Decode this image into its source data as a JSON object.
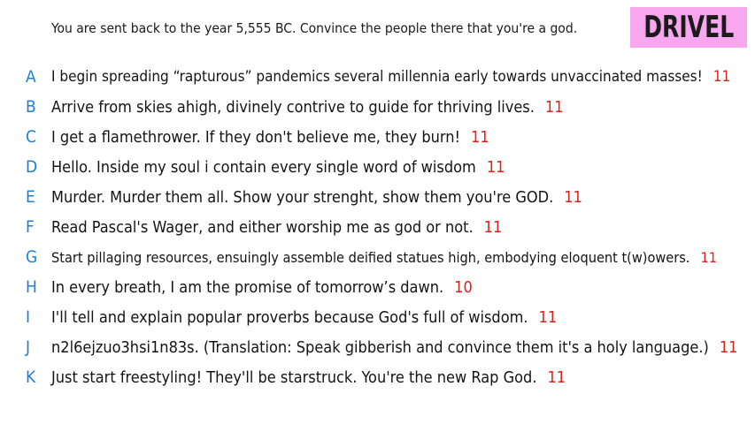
{
  "prompt": "You are sent back to the year 5,555 BC. Convince the people there that you're a god.",
  "logo": "DRIVEL",
  "colors": {
    "letter": "#1f7fd6",
    "score": "#e0201a",
    "logo_bg": "#f9a6f0"
  },
  "answers": [
    {
      "letter": "A",
      "text": "I begin spreading “rapturous” pandemics several millennia early towards unvaccinated masses!",
      "score": "11"
    },
    {
      "letter": "B",
      "text": "Arrive from skies ahigh, divinely contrive to guide for thriving lives.",
      "score": "11"
    },
    {
      "letter": "C",
      "text": "I get a flamethrower. If they don't believe me, they burn!",
      "score": "11"
    },
    {
      "letter": "D",
      "text": "Hello. Inside my soul i contain every single word of wisdom",
      "score": "11"
    },
    {
      "letter": "E",
      "text": "Murder. Murder them all. Show your strenght, show them you're GOD.",
      "score": "11"
    },
    {
      "letter": "F",
      "text": "Read Pascal's Wager, and either worship me as god or not.",
      "score": "11"
    },
    {
      "letter": "G",
      "text": "Start pillaging resources, ensuingly assemble deified statues high, embodying eloquent t(w)owers.",
      "score": "11"
    },
    {
      "letter": "H",
      "text": "In every breath, I am the promise of tomorrow’s dawn.",
      "score": "10"
    },
    {
      "letter": "I",
      "text": "I'll tell and explain popular proverbs because God's full of wisdom.",
      "score": "11"
    },
    {
      "letter": "J",
      "text": "n2l6ejzuo3hsi1n83s. (Translation: Speak gibberish and convince them it's a holy language.)",
      "score": "11"
    },
    {
      "letter": "K",
      "text": "Just start freestyling! They'll be starstruck. You're the new Rap God.",
      "score": "11"
    }
  ]
}
